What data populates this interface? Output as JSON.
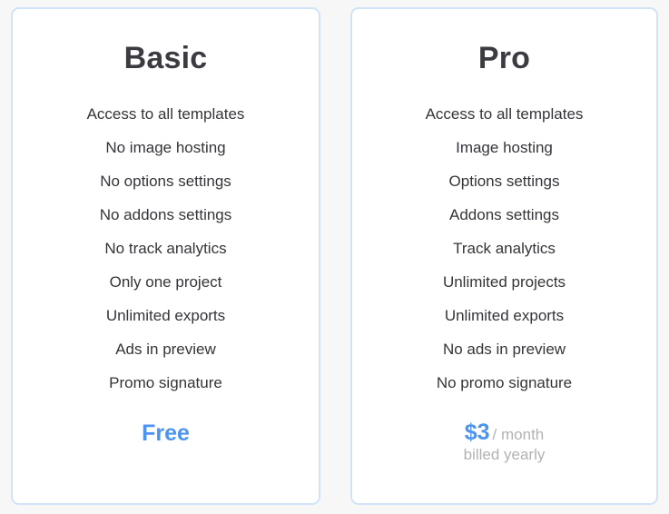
{
  "page": {
    "background_color": "#f7f7f7",
    "card_border_color": "#d0e3f8",
    "accent_color": "#4d94f0",
    "muted_color": "#b2b2b2",
    "text_color": "#34343a"
  },
  "plans": [
    {
      "id": "basic",
      "title": "Basic",
      "features": [
        "Access to all templates",
        "No image hosting",
        "No options settings",
        "No addons settings",
        "No track analytics",
        "Only one project",
        "Unlimited exports",
        "Ads in preview",
        "Promo signature"
      ],
      "price": {
        "amount": "Free",
        "period": "",
        "note": ""
      }
    },
    {
      "id": "pro",
      "title": "Pro",
      "features": [
        "Access to all templates",
        "Image hosting",
        "Options settings",
        "Addons settings",
        "Track analytics",
        "Unlimited projects",
        "Unlimited exports",
        "No ads in preview",
        "No promo signature"
      ],
      "price": {
        "amount": "$3",
        "period": "/ month",
        "note": "billed yearly"
      }
    }
  ]
}
